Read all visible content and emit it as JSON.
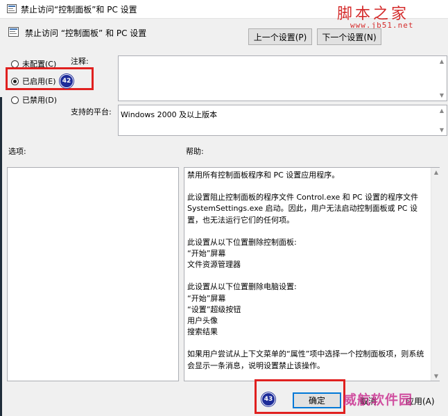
{
  "window": {
    "title": "禁止访问“控制面板”和 PC 设置"
  },
  "watermark": {
    "brand": "脚本之家",
    "url": "www.jb51.net",
    "bottom": "威航软件园"
  },
  "header": {
    "title": "禁止访问 “控制面板” 和 PC 设置"
  },
  "nav": {
    "prev_label": "上一个设置(P)",
    "next_label": "下一个设置(N)"
  },
  "state": {
    "options": [
      {
        "label": "未配置(C)",
        "checked": false
      },
      {
        "label": "已启用(E)",
        "checked": true
      },
      {
        "label": "已禁用(D)",
        "checked": false
      }
    ]
  },
  "annotations": {
    "badge_1": "42",
    "badge_2": "43",
    "accent": "#e0201f"
  },
  "labels": {
    "comment": "注释:",
    "platform": "支持的平台:",
    "options": "选项:",
    "help": "帮助:"
  },
  "platform": {
    "value": "Windows 2000 及以上版本"
  },
  "help": {
    "paragraphs": [
      "禁用所有控制面板程序和 PC 设置应用程序。",
      "此设置阻止控制面板的程序文件 Control.exe 和 PC 设置的程序文件 SystemSettings.exe 启动。因此，用户无法启动控制面板或 PC 设置，也无法运行它们的任何项。",
      "此设置从以下位置删除控制面板:\n“开始”屏幕\n文件资源管理器",
      "此设置从以下位置删除电脑设置:\n“开始”屏幕\n“设置”超级按钮\n用户头像\n搜索结果",
      "如果用户尝试从上下文菜单的“属性”项中选择一个控制面板项，则系统会显示一条消息，说明设置禁止该操作。"
    ]
  },
  "footer": {
    "ok_label": "确定",
    "cancel_label": "取消",
    "apply_label": "应用(A)"
  }
}
